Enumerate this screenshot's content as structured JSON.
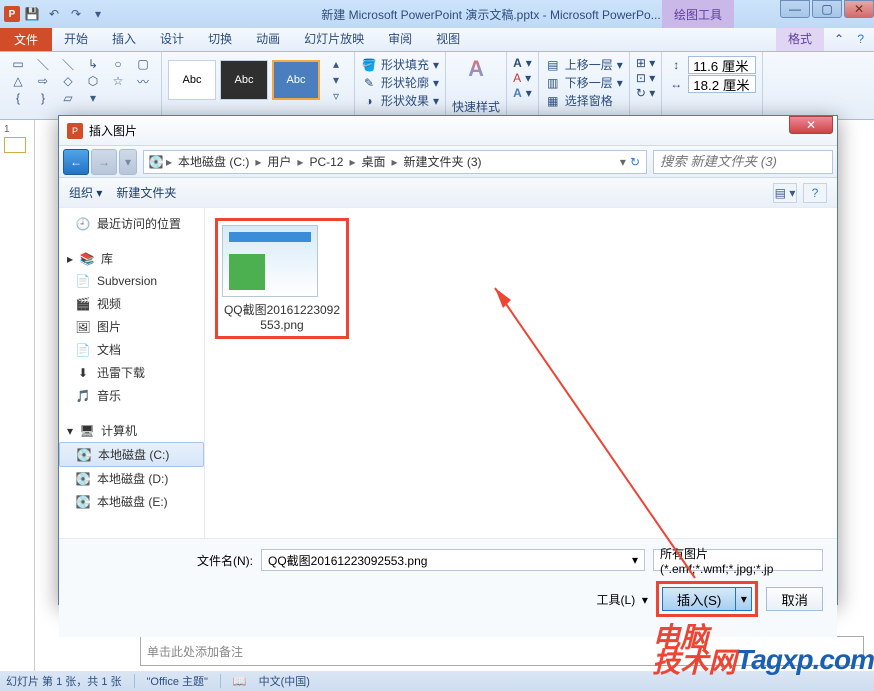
{
  "titlebar": {
    "app_icon": "P",
    "title": "新建 Microsoft PowerPoint 演示文稿.pptx - Microsoft PowerPo...",
    "context_tab": "绘图工具"
  },
  "tabs": {
    "file": "文件",
    "home": "开始",
    "insert": "插入",
    "design": "设计",
    "transitions": "切换",
    "animations": "动画",
    "slideshow": "幻灯片放映",
    "review": "审阅",
    "view": "视图",
    "format": "格式"
  },
  "ribbon": {
    "style_label": "Abc",
    "shape_fill": "形状填充",
    "shape_outline": "形状轮廓",
    "shape_effects": "形状效果",
    "quick_styles": "快速样式",
    "bring_forward": "上移一层",
    "send_backward": "下移一层",
    "selection_pane": "选择窗格",
    "height": "11.6 厘米",
    "width": "18.2 厘米"
  },
  "dialog": {
    "title": "插入图片",
    "breadcrumb": {
      "drive": "本地磁盘 (C:)",
      "users": "用户",
      "pc": "PC-12",
      "desktop": "桌面",
      "folder": "新建文件夹 (3)"
    },
    "search_placeholder": "搜索 新建文件夹 (3)",
    "toolbar": {
      "organize": "组织",
      "new_folder": "新建文件夹"
    },
    "nav": {
      "recent": "最近访问的位置",
      "libraries": "库",
      "subversion": "Subversion",
      "videos": "视频",
      "pictures": "图片",
      "documents": "文档",
      "xunlei": "迅雷下载",
      "music": "音乐",
      "computer": "计算机",
      "drive_c": "本地磁盘 (C:)",
      "drive_d": "本地磁盘 (D:)",
      "drive_e": "本地磁盘 (E:)"
    },
    "file": {
      "name": "QQ截图20161223092553.png"
    },
    "footer": {
      "filename_label": "文件名(N):",
      "filename_value": "QQ截图20161223092553.png",
      "filter": "所有图片(*.emf;*.wmf;*.jpg;*.jp",
      "tools": "工具(L)",
      "insert": "插入(S)",
      "cancel": "取消"
    }
  },
  "notes": "单击此处添加备注",
  "statusbar": {
    "slide": "幻灯片 第 1 张，共 1 张",
    "theme": "\"Office 主题\"",
    "lang": "中文(中国)"
  },
  "thumb_num": "1",
  "watermark": {
    "cn1": "电脑",
    "cn2": "技术网",
    "url": "Tagxp.com"
  }
}
